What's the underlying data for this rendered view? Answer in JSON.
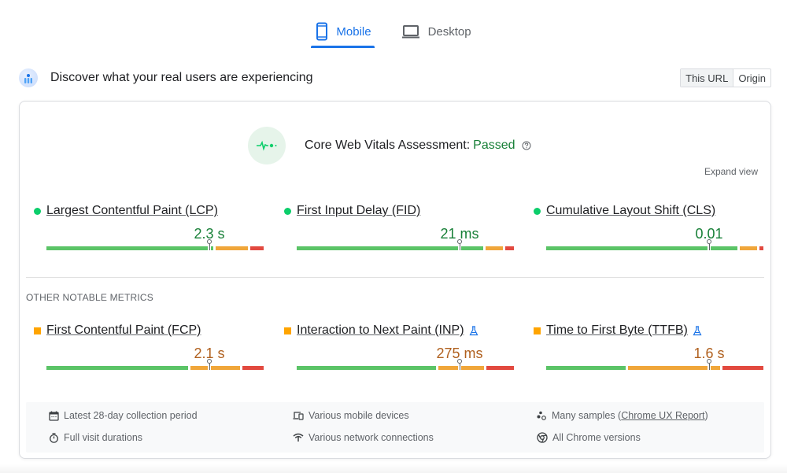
{
  "tabs": [
    {
      "label": "Mobile",
      "icon": "smartphone-icon",
      "active": true
    },
    {
      "label": "Desktop",
      "icon": "laptop-icon",
      "active": false
    }
  ],
  "header": {
    "title": "Discover what your real users are experiencing",
    "icon": "crux-users-icon",
    "scope_options": [
      {
        "label": "This URL",
        "selected": true
      },
      {
        "label": "Origin",
        "selected": false
      }
    ]
  },
  "assessment": {
    "label": "Core Web Vitals Assessment:",
    "status": "Passed",
    "status_color": "#188038",
    "expand_label": "Expand view"
  },
  "core_metrics": [
    {
      "name": "Largest Contentful Paint (LCP)",
      "value": "2.3 s",
      "rating": "good",
      "marker_pct": 75,
      "distribution": [
        {
          "rating": "good",
          "pct": 77
        },
        {
          "rating": "average",
          "pct": 15
        },
        {
          "rating": "poor",
          "pct": 6
        }
      ],
      "good_split_pct": 75
    },
    {
      "name": "First Input Delay (FID)",
      "value": "21 ms",
      "rating": "good",
      "marker_pct": 75,
      "distribution": [
        {
          "rating": "good",
          "pct": 87
        },
        {
          "rating": "average",
          "pct": 8
        },
        {
          "rating": "poor",
          "pct": 4
        }
      ],
      "good_split_pct": 75
    },
    {
      "name": "Cumulative Layout Shift (CLS)",
      "value": "0.01",
      "rating": "good",
      "marker_pct": 75,
      "distribution": [
        {
          "rating": "good",
          "pct": 89
        },
        {
          "rating": "average",
          "pct": 8
        },
        {
          "rating": "poor",
          "pct": 2
        }
      ],
      "good_split_pct": 75
    }
  ],
  "other_label": "OTHER NOTABLE METRICS",
  "other_metrics": [
    {
      "name": "First Contentful Paint (FCP)",
      "value": "2.1 s",
      "rating": "average",
      "experimental": false,
      "marker_pct": 75,
      "distribution": [
        {
          "rating": "good",
          "pct": 66
        },
        {
          "rating": "average",
          "pct": 23
        },
        {
          "rating": "poor",
          "pct": 10
        }
      ]
    },
    {
      "name": "Interaction to Next Paint (INP)",
      "value": "275 ms",
      "rating": "average",
      "experimental": true,
      "marker_pct": 75,
      "distribution": [
        {
          "rating": "good",
          "pct": 65
        },
        {
          "rating": "average",
          "pct": 21
        },
        {
          "rating": "poor",
          "pct": 13
        }
      ]
    },
    {
      "name": "Time to First Byte (TTFB)",
      "value": "1.6 s",
      "rating": "average",
      "experimental": true,
      "marker_pct": 75,
      "distribution": [
        {
          "rating": "good",
          "pct": 37
        },
        {
          "rating": "average",
          "pct": 43
        },
        {
          "rating": "poor",
          "pct": 19
        }
      ]
    }
  ],
  "footer": {
    "items": [
      {
        "icon": "calendar-icon",
        "text": "Latest 28-day collection period"
      },
      {
        "icon": "timer-icon",
        "text": "Full visit durations"
      },
      {
        "icon": "devices-icon",
        "text": "Various mobile devices"
      },
      {
        "icon": "network-icon",
        "text": "Various network connections"
      },
      {
        "icon": "samples-icon",
        "text_before": "Many samples (",
        "link": "Chrome UX Report",
        "text_after": ")"
      },
      {
        "icon": "chrome-icon",
        "text": "All Chrome versions"
      }
    ]
  },
  "colors": {
    "good": "#0cce6b",
    "average": "#ffa400",
    "poor": "#ff4e42",
    "bar_good": "#5bc467",
    "bar_average": "#f0a63a",
    "bar_poor": "#e2493f",
    "accent": "#1a73e8"
  }
}
